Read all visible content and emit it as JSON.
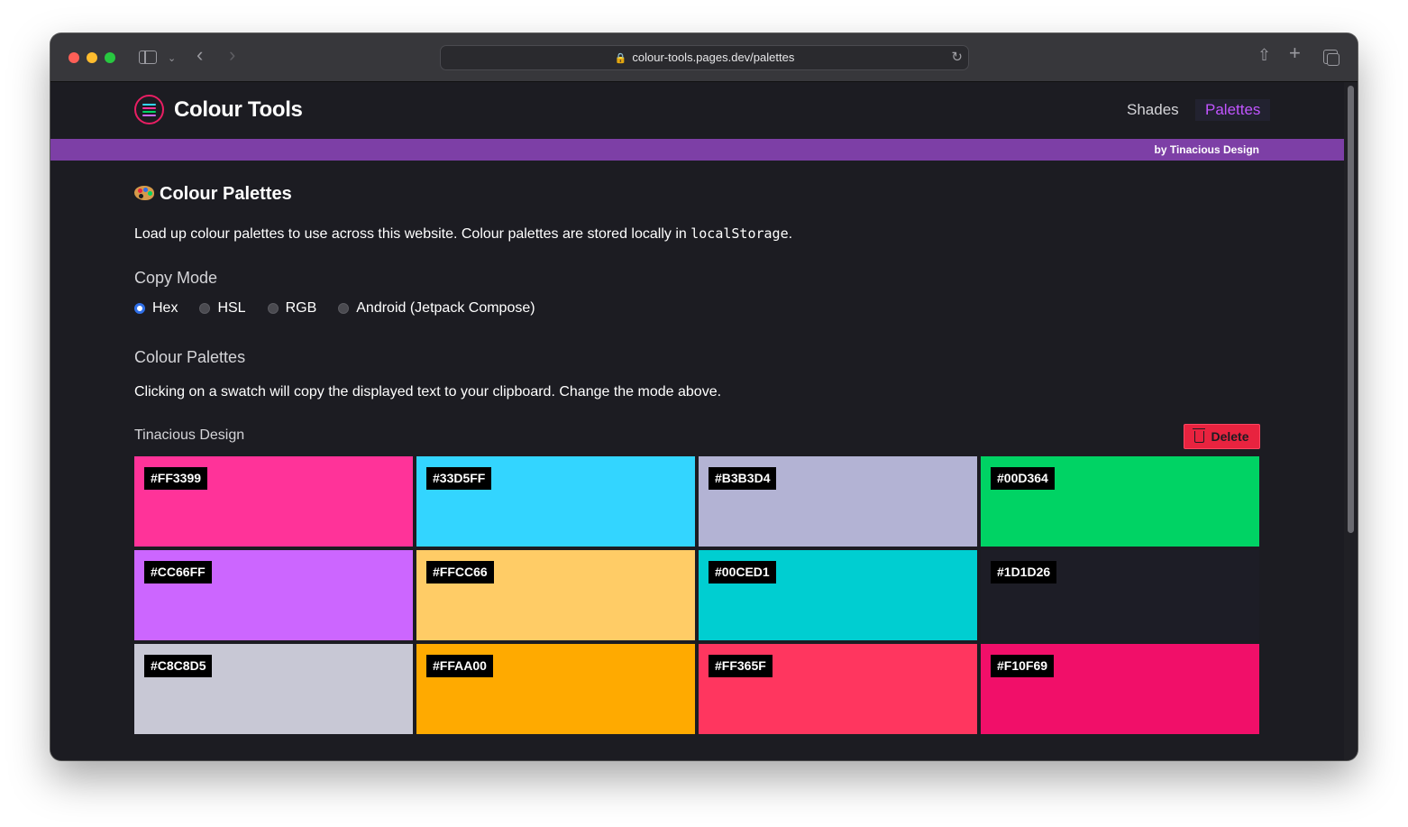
{
  "browser": {
    "url": "colour-tools.pages.dev/palettes"
  },
  "header": {
    "brand": "Colour Tools",
    "nav": [
      {
        "label": "Shades"
      },
      {
        "label": "Palettes"
      }
    ],
    "byline": "by Tinacious Design"
  },
  "page": {
    "title": "Colour Palettes",
    "intro_text": "Load up colour palettes to use across this website. Colour palettes are stored locally in ",
    "intro_code": "localStorage",
    "intro_end": ".",
    "copy_mode": {
      "heading": "Copy Mode",
      "options": [
        {
          "label": "Hex",
          "checked": true
        },
        {
          "label": "HSL",
          "checked": false
        },
        {
          "label": "RGB",
          "checked": false
        },
        {
          "label": "Android (Jetpack Compose)",
          "checked": false
        }
      ]
    },
    "palettes_heading": "Colour Palettes",
    "help_text": "Clicking on a swatch will copy the displayed text to your clipboard. Change the mode above.",
    "palette": {
      "name": "Tinacious Design",
      "delete_label": "Delete",
      "swatches": [
        {
          "label": "#FF3399",
          "color": "#FF3399"
        },
        {
          "label": "#33D5FF",
          "color": "#33D5FF"
        },
        {
          "label": "#B3B3D4",
          "color": "#B3B3D4"
        },
        {
          "label": "#00D364",
          "color": "#00D364"
        },
        {
          "label": "#CC66FF",
          "color": "#CC66FF"
        },
        {
          "label": "#FFCC66",
          "color": "#FFCC66"
        },
        {
          "label": "#00CED1",
          "color": "#00CED1"
        },
        {
          "label": "#1D1D26",
          "color": "#1D1D26"
        },
        {
          "label": "#C8C8D5",
          "color": "#C8C8D5"
        },
        {
          "label": "#FFAA00",
          "color": "#FFAA00"
        },
        {
          "label": "#FF365F",
          "color": "#FF365F"
        },
        {
          "label": "#F10F69",
          "color": "#F10F69"
        }
      ]
    }
  },
  "colors": {
    "accent": "#C155FF",
    "byline_bar": "#7D3FA6",
    "delete": "#E8233F",
    "background": "#1C1C22"
  }
}
